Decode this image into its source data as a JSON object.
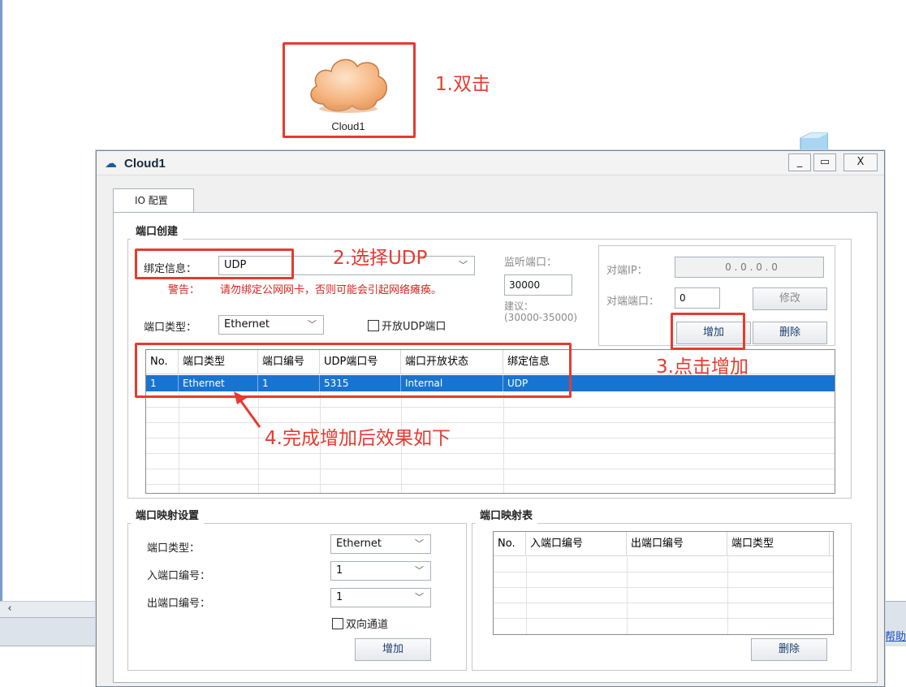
{
  "canvas": {
    "device_label": "Cloud1",
    "help_text": "帮助",
    "scroll_left_glyph": "‹"
  },
  "annotations": {
    "step1": "1.双击",
    "step2": "2.选择UDP",
    "step3": "3.点击增加",
    "step4": "4.完成增加后效果如下",
    "color": "#e53b2f"
  },
  "dialog": {
    "title": "Cloud1",
    "buttons": {
      "minimize": "_",
      "maximize": "▭",
      "close": "X"
    },
    "tab": "IO 配置",
    "port_create": {
      "group_title": "端口创建",
      "bind_label": "绑定信息：",
      "bind_value": "UDP",
      "warning_label": "警告：",
      "warning_text": "请勿绑定公网网卡，否则可能会引起网络瘫痪。",
      "port_type_label": "端口类型：",
      "port_type_value": "Ethernet",
      "open_udp_label": "开放UDP端口",
      "listen_port_label": "监听端口：",
      "listen_port_value": "30000",
      "suggest_label": "建议：",
      "suggest_range": "(30000-35000)",
      "peer_ip_label": "对端IP：",
      "peer_ip_value": "0  .  0  .  0  .  0",
      "peer_port_label": "对端端口：",
      "peer_port_value": "0",
      "modify_button": "修改",
      "add_button": "增加",
      "delete_button": "删除",
      "table": {
        "columns": [
          "No.",
          "端口类型",
          "端口编号",
          "UDP端口号",
          "端口开放状态",
          "绑定信息"
        ],
        "rows": [
          [
            "1",
            "Ethernet",
            "1",
            "5315",
            "Internal",
            "UDP"
          ]
        ]
      }
    },
    "port_mapping_settings": {
      "group_title": "端口映射设置",
      "port_type_label": "端口类型：",
      "port_type_value": "Ethernet",
      "in_port_label": "入端口编号：",
      "in_port_value": "1",
      "out_port_label": "出端口编号：",
      "out_port_value": "1",
      "bidirectional_label": "双向通道",
      "add_button": "增加"
    },
    "port_mapping_table": {
      "group_title": "端口映射表",
      "columns": [
        "No.",
        "入端口编号",
        "出端口编号",
        "端口类型"
      ],
      "delete_button": "删除"
    }
  },
  "colors": {
    "selection": "#1874d2",
    "warning": "#d8251f",
    "cloud_fill": "#f6b784",
    "cloud_stroke": "#c77a3e"
  }
}
